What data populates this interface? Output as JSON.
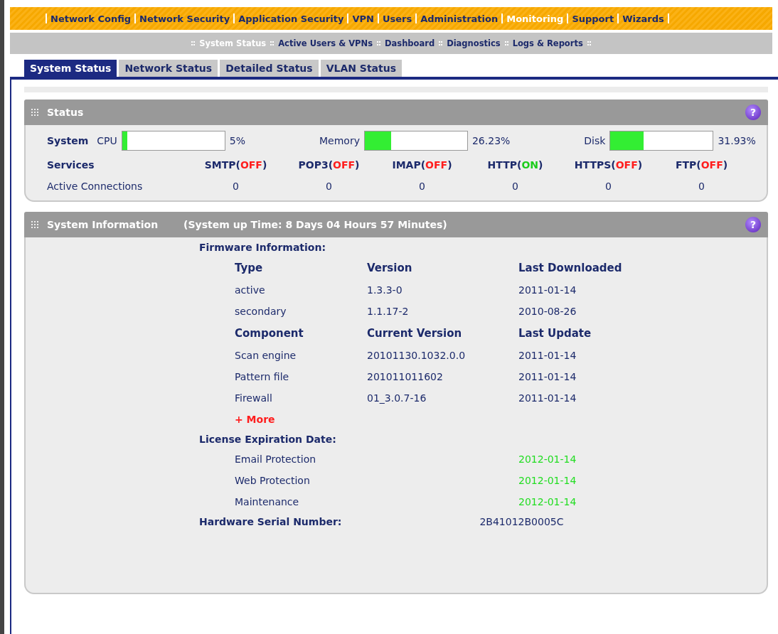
{
  "main_nav": [
    {
      "label": "Network Config",
      "selected": false
    },
    {
      "label": "Network Security",
      "selected": false
    },
    {
      "label": "Application Security",
      "selected": false
    },
    {
      "label": "VPN",
      "selected": false
    },
    {
      "label": "Users",
      "selected": false
    },
    {
      "label": "Administration",
      "selected": false
    },
    {
      "label": "Monitoring",
      "selected": true
    },
    {
      "label": "Support",
      "selected": false
    },
    {
      "label": "Wizards",
      "selected": false
    }
  ],
  "sub_nav": [
    {
      "label": "System Status",
      "selected": true
    },
    {
      "label": "Active Users & VPNs",
      "selected": false
    },
    {
      "label": "Dashboard",
      "selected": false
    },
    {
      "label": "Diagnostics",
      "selected": false
    },
    {
      "label": "Logs & Reports",
      "selected": false
    }
  ],
  "tabs": [
    {
      "label": "System Status",
      "selected": true
    },
    {
      "label": "Network Status",
      "selected": false
    },
    {
      "label": "Detailed Status",
      "selected": false
    },
    {
      "label": "VLAN Status",
      "selected": false
    }
  ],
  "status": {
    "title": "Status",
    "help": "?",
    "system_label": "System",
    "meters": [
      {
        "name": "CPU",
        "level": 0.05,
        "reading": "5%"
      },
      {
        "name": "Memory",
        "level": 0.26,
        "reading": "26.23%"
      },
      {
        "name": "Disk",
        "level": 0.32,
        "reading": "31.93%"
      }
    ],
    "services_label": "Services",
    "services": [
      {
        "name": "SMTP(",
        "state": "OFF",
        "end": ")",
        "on": false
      },
      {
        "name": "POP3(",
        "state": "OFF",
        "end": ")",
        "on": false
      },
      {
        "name": "IMAP(",
        "state": "OFF",
        "end": ")",
        "on": false
      },
      {
        "name": "HTTP(",
        "state": "ON",
        "end": ")",
        "on": true
      },
      {
        "name": "HTTPS(",
        "state": "OFF",
        "end": ")",
        "on": false
      },
      {
        "name": "FTP(",
        "state": "OFF",
        "end": ")",
        "on": false
      }
    ],
    "connections_label": "Active Connections",
    "connections": [
      "0",
      "0",
      "0",
      "0",
      "0",
      "0"
    ]
  },
  "system_info": {
    "title": "System Information",
    "help": "?",
    "uptime": "(System up Time: 8 Days 04 Hours 57 Minutes)",
    "firmware_heading": "Firmware Information:",
    "firmware_columns": [
      "Type",
      "Version",
      "Last Downloaded"
    ],
    "firmware_rows": [
      [
        "active",
        "1.3.3-0",
        "2011-01-14"
      ],
      [
        "secondary",
        "1.1.17-2",
        "2010-08-26"
      ]
    ],
    "component_columns": [
      "Component",
      "Current Version",
      "Last Update"
    ],
    "component_rows": [
      [
        "Scan engine",
        "20101130.1032.0.0",
        "2011-01-14"
      ],
      [
        "Pattern file",
        "201011011602",
        "2011-01-14"
      ],
      [
        "Firewall",
        "01_3.0.7-16",
        "2011-01-14"
      ]
    ],
    "more_link": "+ More",
    "license_heading": "License Expiration Date:",
    "licenses": [
      {
        "name": "Email Protection",
        "date": "2012-01-14"
      },
      {
        "name": "Web Protection",
        "date": "2012-01-14"
      },
      {
        "name": "Maintenance",
        "date": "2012-01-14"
      }
    ],
    "serial_label": "Hardware Serial Number:",
    "serial": "2B41012B0005C"
  }
}
